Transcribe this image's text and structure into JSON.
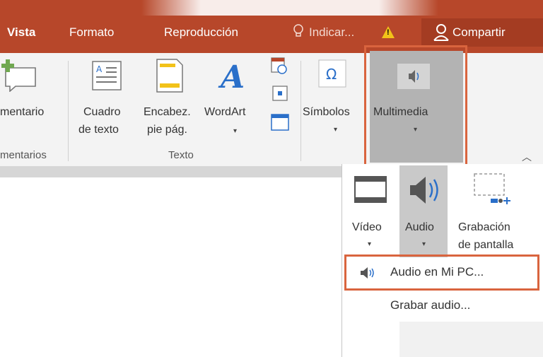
{
  "tabs": [
    {
      "label": "Vista"
    },
    {
      "label": "Formato"
    },
    {
      "label": "Reproducción"
    },
    {
      "label": "Indicar..."
    },
    {
      "label": "Compartir"
    }
  ],
  "ribbon": {
    "comentario_label": "mentario",
    "comentarios_group": "mentarios",
    "cuadro_line1": "Cuadro",
    "cuadro_line2": "de texto",
    "encabez_line1": "Encabez.",
    "encabez_line2": "pie pág.",
    "wordart_label": "WordArt",
    "texto_group": "Texto",
    "simbolos_label": "Símbolos",
    "multimedia_label": "Multimedia"
  },
  "dropdown": {
    "video_label": "Vídeo",
    "audio_label": "Audio",
    "grabacion_line1": "Grabación",
    "grabacion_line2": "de pantalla",
    "audio_en_pc": "Audio en Mi PC...",
    "grabar_audio": "Grabar audio..."
  },
  "colors": {
    "accent": "#b7472a",
    "highlight_border": "#d9643e"
  }
}
